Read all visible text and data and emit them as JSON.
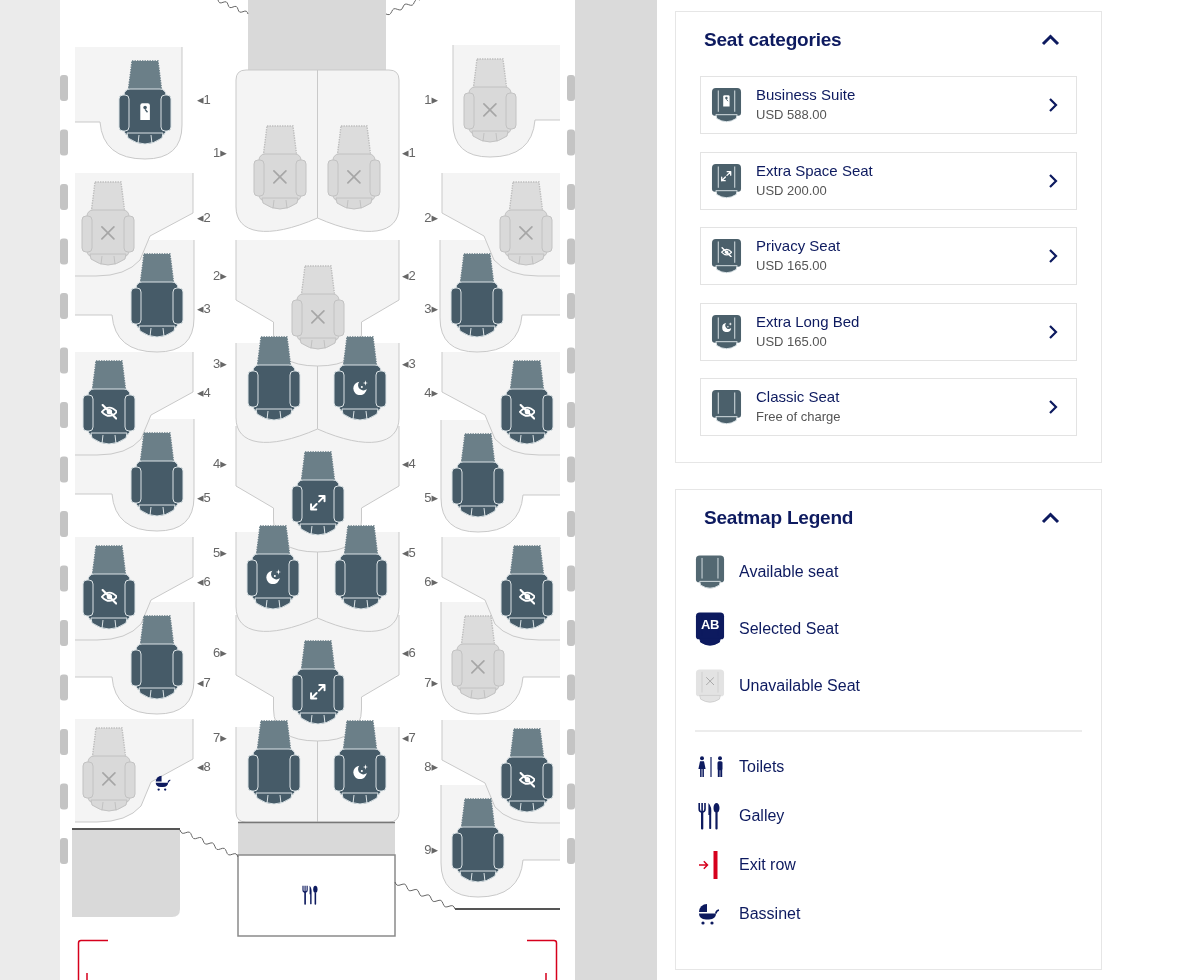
{
  "seatmap": {
    "left_seats": [
      {
        "label": "◂1",
        "available": true,
        "kind": "suite",
        "bassinet": false
      },
      {
        "label": "◂2",
        "available": false,
        "bassinet": false
      },
      {
        "label": "◂3",
        "available": true,
        "kind": "classic",
        "bassinet": false
      },
      {
        "label": "◂4",
        "available": true,
        "kind": "privacy",
        "bassinet": false
      },
      {
        "label": "◂5",
        "available": true,
        "kind": "classic",
        "bassinet": false
      },
      {
        "label": "◂6",
        "available": true,
        "kind": "privacy",
        "bassinet": false
      },
      {
        "label": "◂7",
        "available": true,
        "kind": "classic",
        "bassinet": false
      },
      {
        "label": "◂8",
        "available": false,
        "bassinet": true
      }
    ],
    "center_rows": [
      {
        "labels": [
          "1▸",
          "◂1"
        ],
        "seats": [
          {
            "available": false
          },
          {
            "available": false
          }
        ]
      },
      {
        "labels": [
          "2▸",
          "◂2"
        ],
        "seats": [
          {
            "available": false
          }
        ]
      },
      {
        "labels": [
          "3▸",
          "◂3"
        ],
        "seats": [
          {
            "available": true,
            "kind": "classic"
          },
          {
            "available": true,
            "kind": "long_bed"
          }
        ]
      },
      {
        "labels": [
          "4▸",
          "◂4"
        ],
        "seats": [
          {
            "available": true,
            "kind": "extra_space"
          }
        ]
      },
      {
        "labels": [
          "5▸",
          "◂5"
        ],
        "seats": [
          {
            "available": true,
            "kind": "long_bed"
          },
          {
            "available": true,
            "kind": "classic"
          }
        ]
      },
      {
        "labels": [
          "6▸",
          "◂6"
        ],
        "seats": [
          {
            "available": true,
            "kind": "extra_space"
          }
        ]
      },
      {
        "labels": [
          "7▸",
          "◂7"
        ],
        "seats": [
          {
            "available": true,
            "kind": "classic"
          },
          {
            "available": true,
            "kind": "long_bed"
          }
        ]
      }
    ],
    "right_seats": [
      {
        "label": "1▸",
        "available": false
      },
      {
        "label": "2▸",
        "available": false
      },
      {
        "label": "3▸",
        "available": true,
        "kind": "classic"
      },
      {
        "label": "4▸",
        "available": true,
        "kind": "privacy"
      },
      {
        "label": "5▸",
        "available": true,
        "kind": "classic"
      },
      {
        "label": "6▸",
        "available": true,
        "kind": "privacy"
      },
      {
        "label": "7▸",
        "available": false
      },
      {
        "label": "8▸",
        "available": true,
        "kind": "privacy"
      },
      {
        "label": "9▸",
        "available": true,
        "kind": "classic"
      }
    ]
  },
  "seat_categories": {
    "title": "Seat categories",
    "expanded": true,
    "items": [
      {
        "kind": "suite",
        "name": "Business Suite",
        "price": "USD 588.00"
      },
      {
        "kind": "extra_space",
        "name": "Extra Space Seat",
        "price": "USD 200.00"
      },
      {
        "kind": "privacy",
        "name": "Privacy Seat",
        "price": "USD 165.00"
      },
      {
        "kind": "long_bed",
        "name": "Extra Long Bed",
        "price": "USD 165.00"
      },
      {
        "kind": "classic",
        "name": "Classic Seat",
        "price": "Free of charge"
      }
    ]
  },
  "seatmap_legend": {
    "title": "Seatmap Legend",
    "expanded": true,
    "seat_states": [
      {
        "kind": "available",
        "label": "Available seat"
      },
      {
        "kind": "selected",
        "label": "Selected Seat",
        "code": "AB"
      },
      {
        "kind": "unavailable",
        "label": "Unavailable Seat"
      }
    ],
    "facilities": [
      {
        "kind": "toilets",
        "label": "Toilets"
      },
      {
        "kind": "galley",
        "label": "Galley"
      },
      {
        "kind": "exit_row",
        "label": "Exit row"
      },
      {
        "kind": "bassinet",
        "label": "Bassinet"
      }
    ]
  }
}
